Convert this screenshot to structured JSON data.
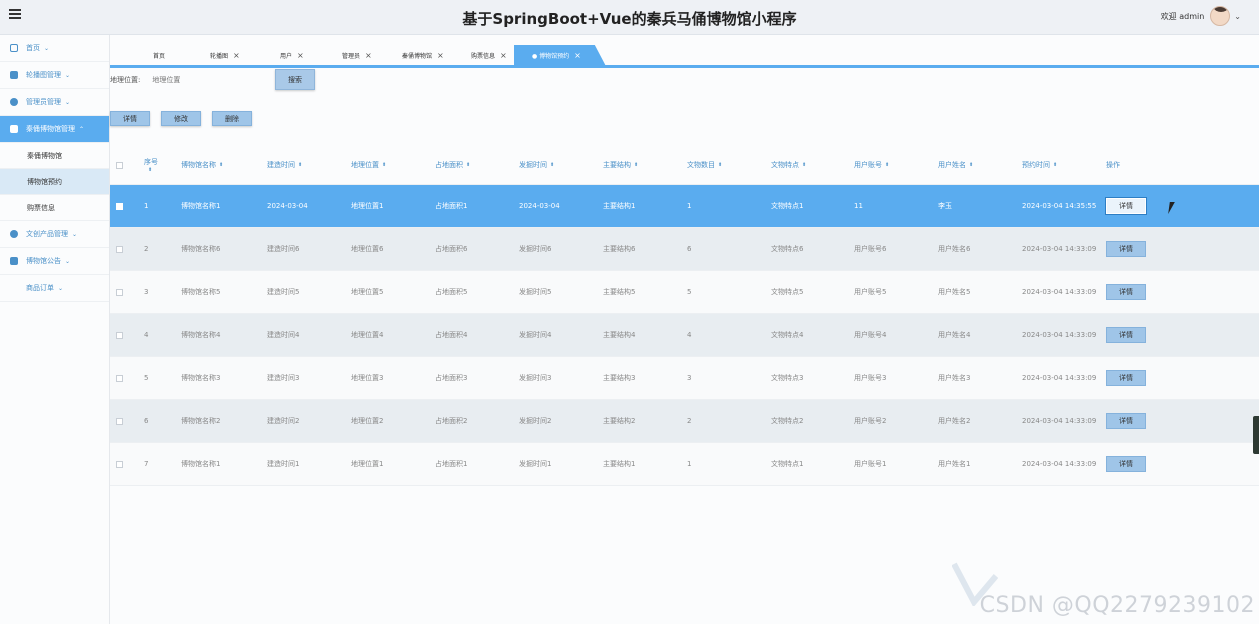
{
  "header": {
    "title": "基于SpringBoot+Vue的秦兵马俑博物馆小程序",
    "welcome": "欢迎 admin"
  },
  "sidebar": {
    "items": [
      {
        "label": "首页",
        "icon": "home-icon"
      },
      {
        "label": "轮播图管理",
        "icon": "grid-icon"
      },
      {
        "label": "管理员管理",
        "icon": "shield-icon"
      },
      {
        "label": "秦俑博物馆管理",
        "icon": "grid-icon",
        "expanded": true
      },
      {
        "label": "文创产品管理",
        "icon": "circle-icon"
      },
      {
        "label": "博物馆公告",
        "icon": "notice-icon"
      },
      {
        "label": "商品订单",
        "icon": ""
      }
    ],
    "subitems": [
      "秦俑博物馆",
      "博物馆预约",
      "购票信息"
    ]
  },
  "tabs": [
    {
      "label": "首页",
      "closable": false
    },
    {
      "label": "轮播图",
      "closable": true
    },
    {
      "label": "用户",
      "closable": true
    },
    {
      "label": "管理员",
      "closable": true
    },
    {
      "label": "秦俑博物馆",
      "closable": true
    },
    {
      "label": "购票信息",
      "closable": true
    },
    {
      "label": "● 博物馆预约",
      "closable": true,
      "active": true
    }
  ],
  "search": {
    "label": "地理位置:",
    "placeholder": "地理位置",
    "button": "搜索"
  },
  "actions": {
    "detail": "详情",
    "edit": "修改",
    "delete": "删除"
  },
  "table": {
    "seq_header": "序号",
    "columns": [
      "博物馆名称",
      "建造时间",
      "地理位置",
      "占地面积",
      "发掘时间",
      "主要结构",
      "文物数目",
      "文物特点",
      "用户账号",
      "用户姓名",
      "预约时间",
      "操作"
    ],
    "rows": [
      {
        "seq": "1",
        "name": "博物馆名称1",
        "built": "2024-03-04",
        "location": "地理位置1",
        "area": "占地面积1",
        "excavated": "2024-03-04",
        "structure": "主要结构1",
        "count": "1",
        "feature": "文物特点1",
        "account": "11",
        "username": "李玉",
        "time": "2024-03-04 14:35:55",
        "selected": true
      },
      {
        "seq": "2",
        "name": "博物馆名称6",
        "built": "建造时间6",
        "location": "地理位置6",
        "area": "占地面积6",
        "excavated": "发掘时间6",
        "structure": "主要结构6",
        "count": "6",
        "feature": "文物特点6",
        "account": "用户账号6",
        "username": "用户姓名6",
        "time": "2024-03-04 14:33:09"
      },
      {
        "seq": "3",
        "name": "博物馆名称5",
        "built": "建造时间5",
        "location": "地理位置5",
        "area": "占地面积5",
        "excavated": "发掘时间5",
        "structure": "主要结构5",
        "count": "5",
        "feature": "文物特点5",
        "account": "用户账号5",
        "username": "用户姓名5",
        "time": "2024-03-04 14:33:09"
      },
      {
        "seq": "4",
        "name": "博物馆名称4",
        "built": "建造时间4",
        "location": "地理位置4",
        "area": "占地面积4",
        "excavated": "发掘时间4",
        "structure": "主要结构4",
        "count": "4",
        "feature": "文物特点4",
        "account": "用户账号4",
        "username": "用户姓名4",
        "time": "2024-03-04 14:33:09"
      },
      {
        "seq": "5",
        "name": "博物馆名称3",
        "built": "建造时间3",
        "location": "地理位置3",
        "area": "占地面积3",
        "excavated": "发掘时间3",
        "structure": "主要结构3",
        "count": "3",
        "feature": "文物特点3",
        "account": "用户账号3",
        "username": "用户姓名3",
        "time": "2024-03-04 14:33:09"
      },
      {
        "seq": "6",
        "name": "博物馆名称2",
        "built": "建造时间2",
        "location": "地理位置2",
        "area": "占地面积2",
        "excavated": "发掘时间2",
        "structure": "主要结构2",
        "count": "2",
        "feature": "文物特点2",
        "account": "用户账号2",
        "username": "用户姓名2",
        "time": "2024-03-04 14:33:09"
      },
      {
        "seq": "7",
        "name": "博物馆名称1",
        "built": "建造时间1",
        "location": "地理位置1",
        "area": "占地面积1",
        "excavated": "发掘时间1",
        "structure": "主要结构1",
        "count": "1",
        "feature": "文物特点1",
        "account": "用户账号1",
        "username": "用户姓名1",
        "time": "2024-03-04 14:33:09"
      }
    ],
    "row_button": "详情"
  },
  "watermark": "CSDN @QQ2279239102",
  "colors": {
    "accent": "#5aacef",
    "button": "#9fc5e8",
    "header_text": "#4a90c8"
  }
}
